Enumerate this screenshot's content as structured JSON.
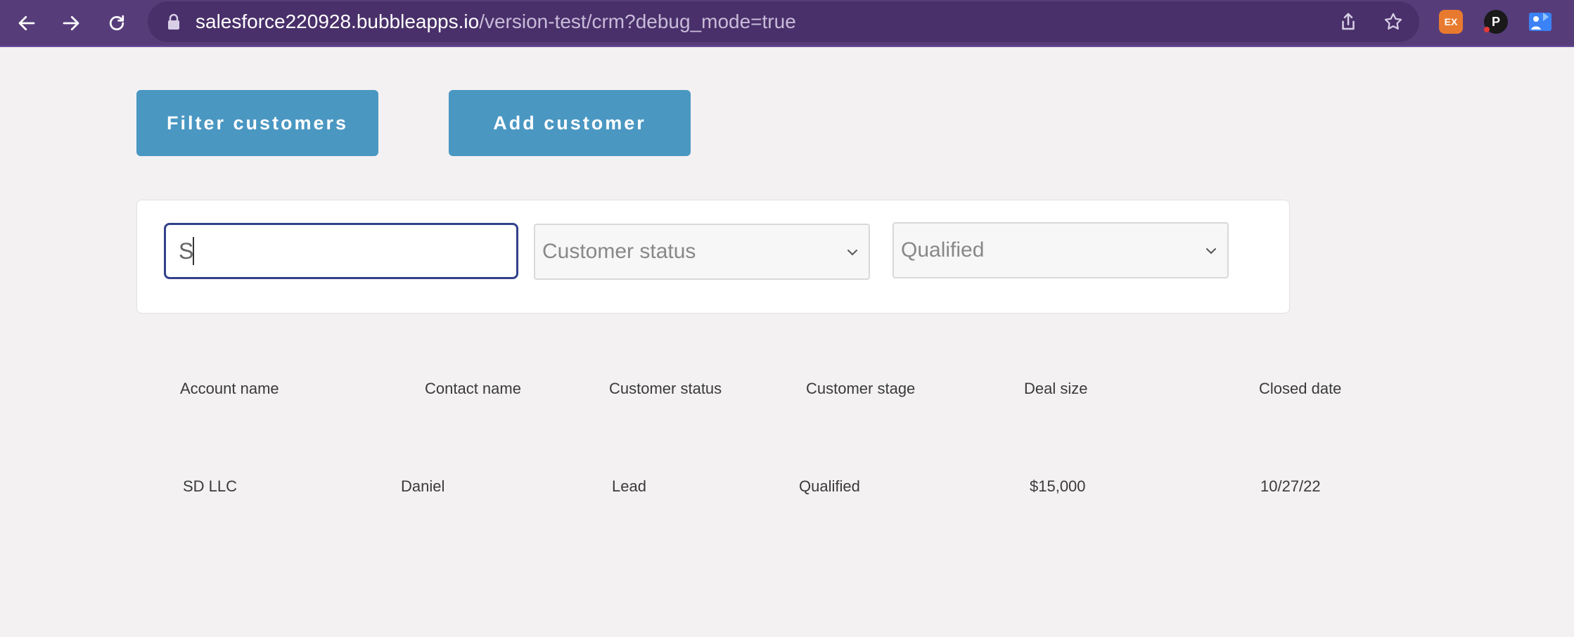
{
  "browser": {
    "url_host": "salesforce220928.bubbleapps.io",
    "url_path": "/version-test/crm?debug_mode=true",
    "extensions": {
      "ex_label": "EX",
      "p_label": "P"
    }
  },
  "toolbar": {
    "filter_label": "Filter customers",
    "add_label": "Add customer"
  },
  "filters": {
    "search_value": "S",
    "status_placeholder": "Customer status",
    "stage_value": "Qualified"
  },
  "table": {
    "headers": [
      "Account name",
      "Contact name",
      "Customer status",
      "Customer stage",
      "Deal size",
      "Closed date"
    ],
    "rows": [
      [
        "SD LLC",
        "Daniel",
        "Lead",
        "Qualified",
        "$15,000",
        "10/27/22"
      ]
    ]
  }
}
